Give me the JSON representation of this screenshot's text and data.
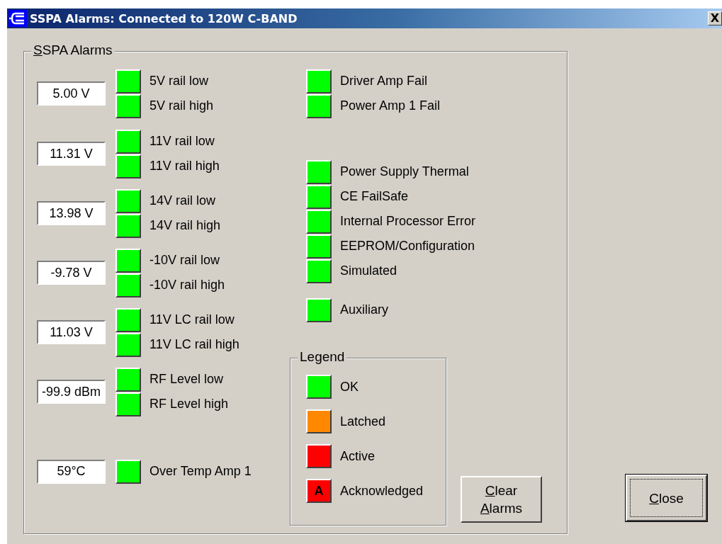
{
  "window": {
    "title": "SSPA Alarms: Connected to 120W C-BAND",
    "close_label": "X"
  },
  "group": {
    "label_parts": [
      "S",
      "SPA Alarms"
    ]
  },
  "readings": [
    {
      "value": "5.00 V",
      "alarms": [
        {
          "label": "5V rail low",
          "color": "#00ff00"
        },
        {
          "label": "5V rail high",
          "color": "#00ff00"
        }
      ]
    },
    {
      "value": "11.31 V",
      "alarms": [
        {
          "label": "11V rail low",
          "color": "#00ff00"
        },
        {
          "label": "11V rail high",
          "color": "#00ff00"
        }
      ]
    },
    {
      "value": "13.98 V",
      "alarms": [
        {
          "label": "14V rail low",
          "color": "#00ff00"
        },
        {
          "label": "14V rail high",
          "color": "#00ff00"
        }
      ]
    },
    {
      "value": "-9.78 V",
      "alarms": [
        {
          "label": "-10V rail low",
          "color": "#00ff00"
        },
        {
          "label": "-10V rail high",
          "color": "#00ff00"
        }
      ]
    },
    {
      "value": "11.03 V",
      "alarms": [
        {
          "label": "11V LC rail low",
          "color": "#00ff00"
        },
        {
          "label": "11V LC rail high",
          "color": "#00ff00"
        }
      ]
    },
    {
      "value": "-99.9 dBm",
      "alarms": [
        {
          "label": "RF Level low",
          "color": "#00ff00"
        },
        {
          "label": "RF Level high",
          "color": "#00ff00"
        }
      ]
    },
    {
      "value": "59°C",
      "alarms": [
        {
          "label": "Over Temp Amp 1",
          "color": "#00ff00"
        }
      ]
    }
  ],
  "other_alarms": [
    [
      {
        "label": "Driver Amp Fail",
        "color": "#00ff00"
      },
      {
        "label": "Power Amp 1 Fail",
        "color": "#00ff00"
      }
    ],
    [
      {
        "label": "Power Supply Thermal",
        "color": "#00ff00"
      },
      {
        "label": "CE FailSafe",
        "color": "#00ff00"
      },
      {
        "label": "Internal Processor Error",
        "color": "#00ff00"
      },
      {
        "label": "EEPROM/Configuration",
        "color": "#00ff00"
      },
      {
        "label": "Simulated",
        "color": "#00ff00"
      }
    ],
    [
      {
        "label": "Auxiliary",
        "color": "#00ff00"
      }
    ]
  ],
  "legend": {
    "title": "Legend",
    "items": [
      {
        "label": "OK",
        "color": "#00ff00"
      },
      {
        "label": "Latched",
        "color": "#ff8800"
      },
      {
        "label": "Active",
        "color": "#ff0000"
      },
      {
        "label": "Acknowledged",
        "color": "#ff0000",
        "mark": "A"
      }
    ]
  },
  "buttons": {
    "clear": [
      "C",
      "lear ",
      "A",
      "larms"
    ],
    "close": [
      "C",
      "lose"
    ]
  }
}
